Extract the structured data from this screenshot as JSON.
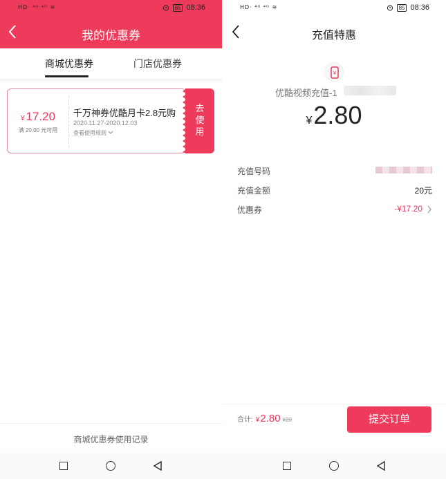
{
  "status_bar": {
    "left_icons": "HD· ⁴ᴳ ⁴ᴳ ≋",
    "battery": "85",
    "time": "08:36"
  },
  "left_screen": {
    "title": "我的优惠券",
    "tabs": [
      {
        "label": "商城优惠券",
        "active": true
      },
      {
        "label": "门店优惠券",
        "active": false
      }
    ],
    "coupon": {
      "currency": "¥",
      "amount": "17.20",
      "condition": "满 20.00 元可用",
      "name": "千万神券优酷月卡2.8元购",
      "date_range": "2020.11.27-2020.12.03",
      "rules_link": "查看使用规则",
      "use_button_lines": [
        "去",
        "使",
        "用"
      ]
    },
    "footer_link": "商城优惠券使用记录"
  },
  "right_screen": {
    "title": "充值特惠",
    "product_name": "优酷视频充值-1",
    "currency": "¥",
    "price": "2.80",
    "rows": [
      {
        "label": "充值号码",
        "value": ""
      },
      {
        "label": "充值金额",
        "value": "20元"
      },
      {
        "label": "优惠券",
        "value": "-¥17.20"
      }
    ],
    "total": {
      "label": "合计:",
      "currency": "¥",
      "amount": "2.80",
      "original": "¥20"
    },
    "submit_label": "提交订单"
  },
  "colors": {
    "accent": "#ef3b5b",
    "price_red": "#e8355a"
  },
  "icons": [
    "back-chevron-icon",
    "alarm-icon",
    "battery-icon",
    "phone-recharge-icon",
    "chevron-right-icon",
    "chevron-down-icon",
    "nav-recent-icon",
    "nav-home-icon",
    "nav-back-icon"
  ]
}
